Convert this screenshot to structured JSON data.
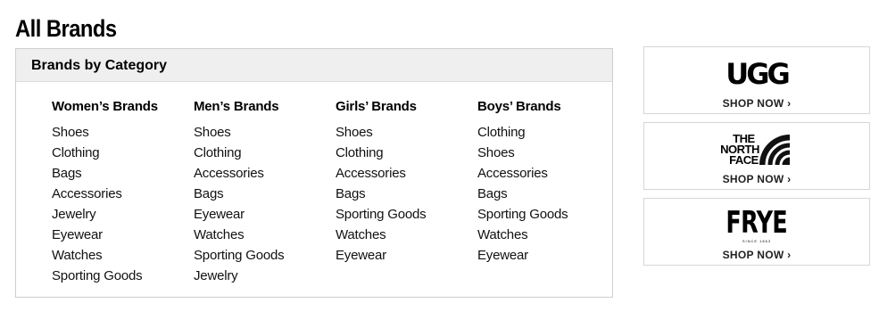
{
  "page": {
    "title": "All Brands"
  },
  "category_box": {
    "title": "Brands by Category",
    "columns": [
      {
        "heading": "Women’s Brands",
        "links": [
          "Shoes",
          "Clothing",
          "Bags",
          "Accessories",
          "Jewelry",
          "Eyewear",
          "Watches",
          "Sporting Goods"
        ]
      },
      {
        "heading": "Men’s Brands",
        "links": [
          "Shoes",
          "Clothing",
          "Accessories",
          "Bags",
          "Eyewear",
          "Watches",
          "Sporting Goods",
          "Jewelry"
        ]
      },
      {
        "heading": "Girls’ Brands",
        "links": [
          "Shoes",
          "Clothing",
          "Accessories",
          "Bags",
          "Sporting Goods",
          "Watches",
          "Eyewear"
        ]
      },
      {
        "heading": "Boys’ Brands",
        "links": [
          "Clothing",
          "Shoes",
          "Accessories",
          "Bags",
          "Sporting Goods",
          "Watches",
          "Eyewear"
        ]
      }
    ]
  },
  "promos": [
    {
      "brand": "UGG",
      "cta": "SHOP NOW ›"
    },
    {
      "brand": "THE NORTH FACE",
      "logo_lines": [
        "THE",
        "NORTH",
        "FACE"
      ],
      "cta": "SHOP NOW ›"
    },
    {
      "brand": "FRYE",
      "tagline": "SINCE 1863",
      "cta": "SHOP NOW ›"
    }
  ]
}
